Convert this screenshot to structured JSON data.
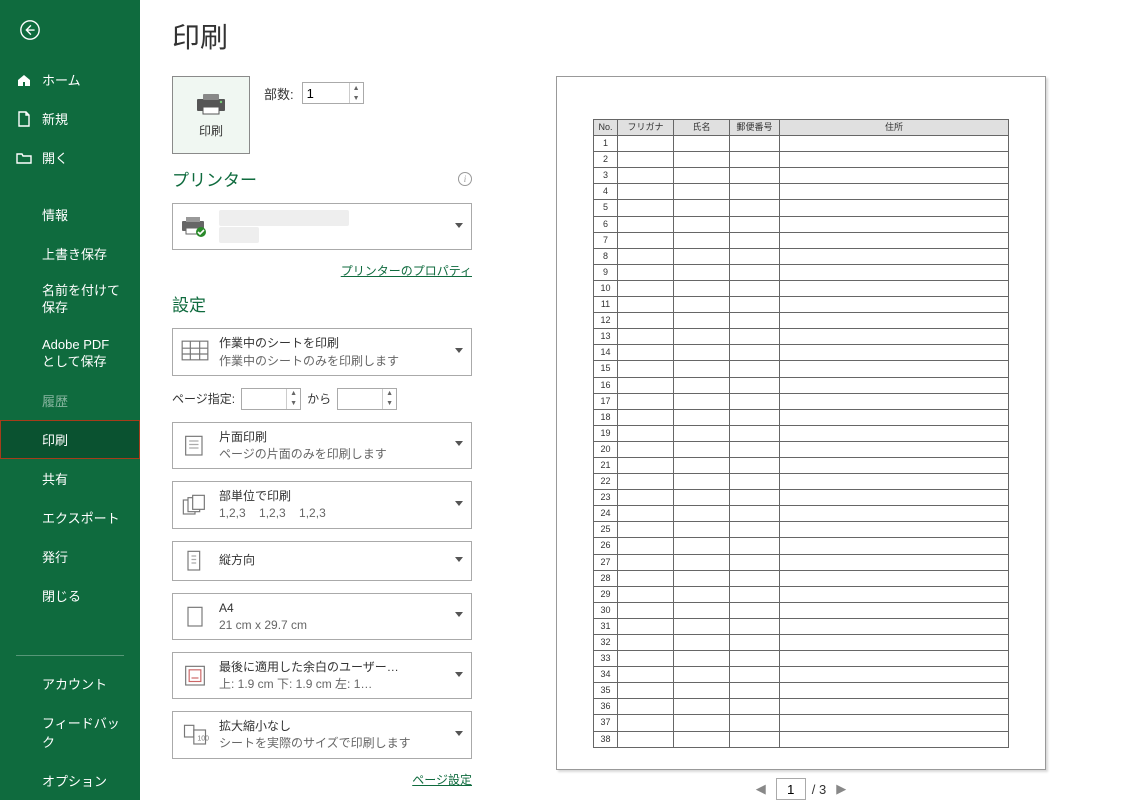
{
  "sidebar": {
    "home": "ホーム",
    "new": "新規",
    "open": "開く",
    "info": "情報",
    "save": "上書き保存",
    "saveas": "名前を付けて保存",
    "adobe": "Adobe PDF として保存",
    "history": "履歴",
    "print": "印刷",
    "share": "共有",
    "export": "エクスポート",
    "publish": "発行",
    "close": "閉じる",
    "account": "アカウント",
    "feedback": "フィードバック",
    "options": "オプション"
  },
  "page": {
    "title": "印刷"
  },
  "print": {
    "button_label": "印刷",
    "copies_label": "部数:",
    "copies_value": "1"
  },
  "printer": {
    "section": "プリンター",
    "link": "プリンターのプロパティ"
  },
  "settings": {
    "section": "設定",
    "active_sheets": {
      "title": "作業中のシートを印刷",
      "sub": "作業中のシートのみを印刷します"
    },
    "page_range": {
      "label": "ページ指定:",
      "to": "から"
    },
    "one_sided": {
      "title": "片面印刷",
      "sub": "ページの片面のみを印刷します"
    },
    "collated": {
      "title": "部単位で印刷",
      "sub": "1,2,3    1,2,3    1,2,3"
    },
    "orientation": {
      "title": "縦方向"
    },
    "paper": {
      "title": "A4",
      "sub": "21 cm x 29.7 cm"
    },
    "margins": {
      "title": "最後に適用した余白のユーザー設定",
      "sub": "上: 1.9 cm 下: 1.9 cm 左: 1…"
    },
    "scaling": {
      "title": "拡大縮小なし",
      "sub": "シートを実際のサイズで印刷します"
    },
    "page_setup_link": "ページ設定"
  },
  "preview": {
    "headers": [
      "No.",
      "フリガナ",
      "氏名",
      "郵便番号",
      "住所"
    ],
    "row_count": 38,
    "current_page": "1",
    "total_pages": "3"
  }
}
